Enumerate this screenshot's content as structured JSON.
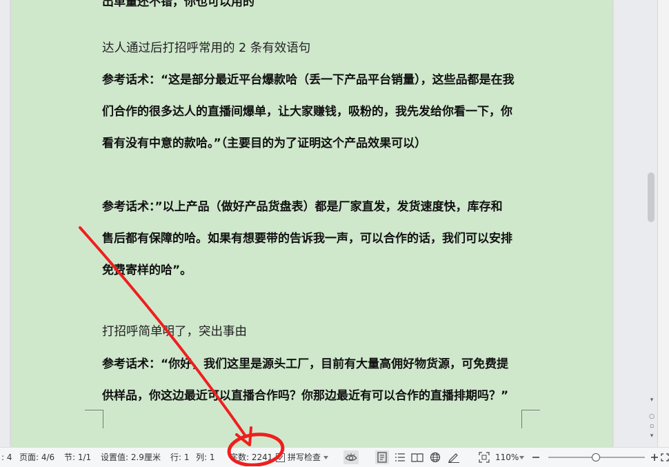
{
  "document": {
    "top_partial": "出单量还不错，你也可以用的",
    "heading1": "达人通过后打招呼常用的 2 条有效语句",
    "p1_l1": "参考话术：“这是部分最近平台爆款哈（丢一下产品平台销量），这些品都是在我",
    "p1_l2": "们合作的很多达人的直播间爆单，让大家赚钱，吸粉的，我先发给你看一下，你",
    "p1_l3": "看有没有中意的款哈。”（主要目的为了证明这个产品效果可以）",
    "p2_l1": "参考话术：”以上产品（做好产品货盘表）都是厂家直发，发货速度快，库存和",
    "p2_l2": "售后都有保障的哈。如果有想要带的告诉我一声，可以合作的话，我们可以安排",
    "p2_l3": "免费寄样的哈”。",
    "heading2": "打招呼简单明了，突出事由",
    "p3_l1": "参考话术：“你好，我们这里是源头工厂，目前有大量高佣好物货源，可免费提",
    "p3_l2": "供样品，你这边最近可以直播合作吗？你那边最近有可以合作的直播排期吗？”"
  },
  "statusbar": {
    "truncated": ": 4",
    "page": "页面: 4/6",
    "section": "节: 1/1",
    "setting": "设置值: 2.9厘米",
    "row": "行: 1",
    "col": "列: 1",
    "wordcount": "字数: 2241",
    "spellcheck": "拼写检查",
    "zoom": "110%",
    "zoom_level_percent": 110
  },
  "annotation": {
    "color": "#f01e1e"
  },
  "icons": [
    "check-icon",
    "dropdown-icon",
    "eye-icon",
    "page-view-icon",
    "outline-icon",
    "reading-icon",
    "web-icon",
    "pen-icon",
    "fit-screen-icon",
    "zoom-out-icon",
    "zoom-in-icon",
    "fullscreen-icon"
  ]
}
